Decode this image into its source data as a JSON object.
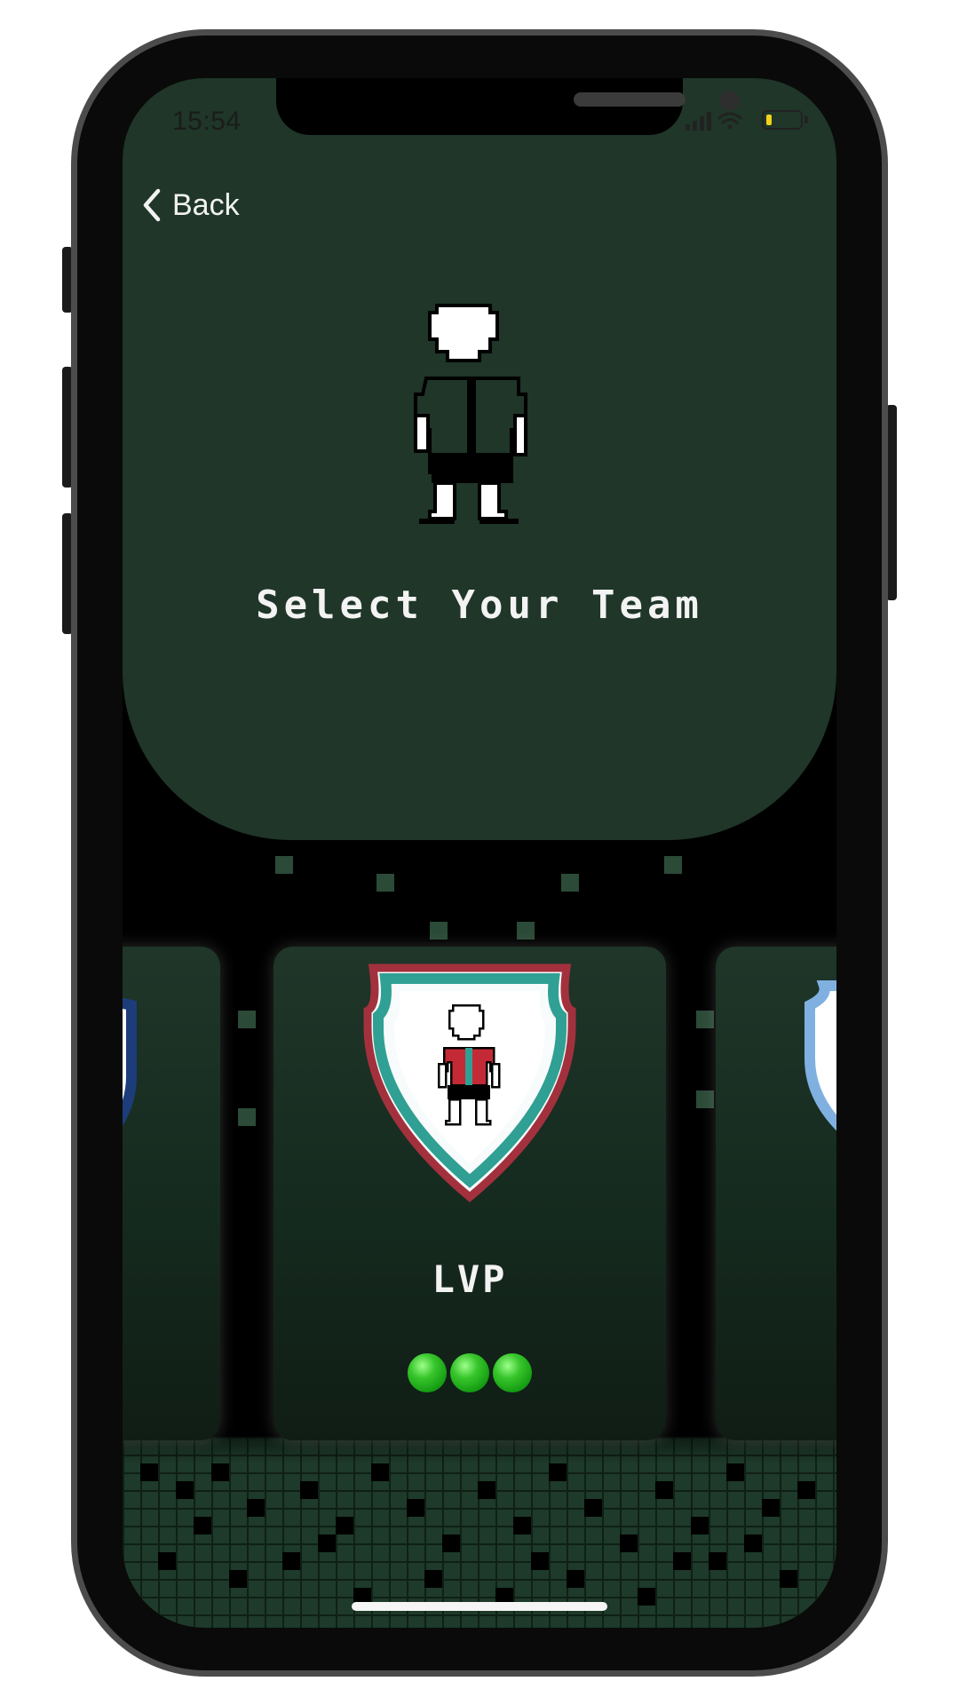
{
  "status_bar": {
    "time": "15:54",
    "icons": [
      "cellular-signal-icon",
      "wifi-icon",
      "battery-low-icon"
    ],
    "battery_color": "#f2d21b"
  },
  "nav": {
    "back_label": "Back"
  },
  "header": {
    "title": "Select Your Team",
    "background_color": "#1f3629"
  },
  "teams": {
    "selected": {
      "name": "LVP",
      "rating": 3,
      "rating_color": "#37c52b",
      "shield_colors": {
        "border": "#a3313d",
        "stripe": "#2fa093",
        "jersey": "#c32a36"
      }
    },
    "previous": {
      "shield_colors": {
        "border": "#1d3d7a",
        "accent": "#c3283a"
      }
    },
    "next": {
      "shield_colors": {
        "border": "#7fb0e0"
      }
    }
  }
}
